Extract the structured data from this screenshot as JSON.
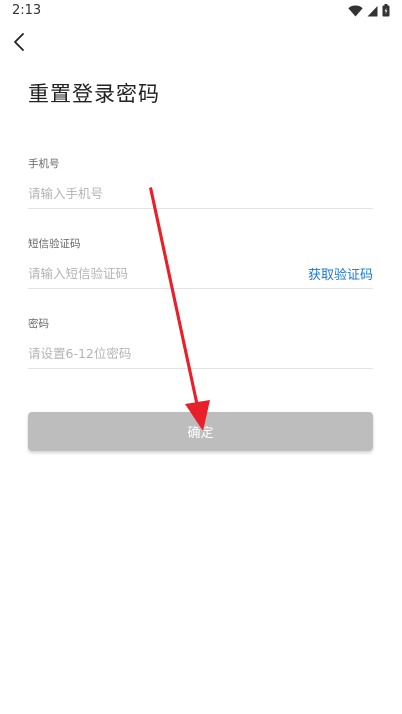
{
  "status_bar": {
    "time": "2:13"
  },
  "header": {
    "back_icon": "chevron-left-icon",
    "title": "重置登录密码"
  },
  "form": {
    "phone": {
      "label": "手机号",
      "placeholder": "请输入手机号",
      "value": ""
    },
    "sms_code": {
      "label": "短信验证码",
      "placeholder": "请输入短信验证码",
      "value": "",
      "get_code_label": "获取验证码"
    },
    "password": {
      "label": "密码",
      "placeholder": "请设置6-12位密码",
      "value": ""
    }
  },
  "confirm_button": {
    "label": "确定"
  },
  "colors": {
    "accent_link": "#1677d6",
    "button_disabled": "#bdbdbd",
    "annotation_arrow": "#e8202a"
  }
}
